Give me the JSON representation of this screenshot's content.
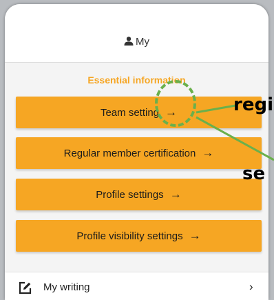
{
  "header": {
    "title": "My",
    "icon": "person-icon"
  },
  "section": {
    "title": "Essential information"
  },
  "menu": [
    {
      "label": "Team setting",
      "arrow": "→"
    },
    {
      "label": "Regular member certification",
      "arrow": "→"
    },
    {
      "label": "Profile settings",
      "arrow": "→"
    },
    {
      "label": "Profile visibility settings",
      "arrow": "→"
    }
  ],
  "list": [
    {
      "label": "My writing",
      "icon": "edit-icon",
      "chevron": "›"
    }
  ],
  "annotation": {
    "text_1": "regi",
    "text_2": "se",
    "color": "#6ab04c"
  },
  "colors": {
    "accent": "#f6a623",
    "annotation": "#6ab04c"
  }
}
